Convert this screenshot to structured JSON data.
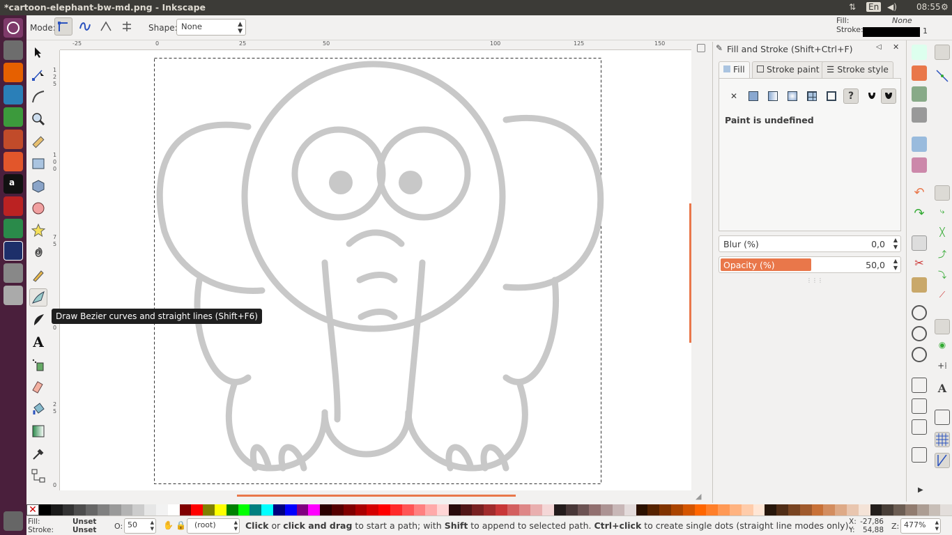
{
  "window": {
    "title": "*cartoon-elephant-bw-md.png - Inkscape"
  },
  "tray": {
    "keyboard": "En",
    "time": "08:55"
  },
  "top_style": {
    "fill_label": "Fill:",
    "fill_value": "None",
    "stroke_label": "Stroke:",
    "stroke_width": "1"
  },
  "toolbar": {
    "mode_label": "Mode:",
    "shape_label": "Shape:",
    "shape_value": "None"
  },
  "ruler": {
    "h_ticks": [
      "-25",
      "0",
      "25",
      "50",
      "100",
      "125",
      "150"
    ],
    "v_ticks": [
      "1",
      "2",
      "5",
      "1",
      "0",
      "0",
      "7",
      "5",
      "5",
      "0",
      "2",
      "5",
      "0"
    ]
  },
  "tooltip": "Draw Bezier curves and straight lines (Shift+F6)",
  "panel": {
    "title": "Fill and Stroke (Shift+Ctrl+F)",
    "tabs": [
      "Fill",
      "Stroke paint",
      "Stroke style"
    ],
    "paint_status": "Paint is undefined",
    "blur_label": "Blur (%)",
    "blur_value": "0,0",
    "opacity_label": "Opacity (%)",
    "opacity_value": "50,0",
    "opacity_fraction": 0.5
  },
  "status": {
    "fill_label": "Fill:",
    "fill_value": "Unset",
    "stroke_label": "Stroke:",
    "stroke_value": "Unset",
    "o_label": "O:",
    "o_value": "50",
    "layer": "(root)",
    "message_parts": [
      {
        "t": "Click",
        "b": true
      },
      {
        "t": " or ",
        "b": false
      },
      {
        "t": "click and drag",
        "b": true
      },
      {
        "t": " to start a path; with ",
        "b": false
      },
      {
        "t": "Shift",
        "b": true
      },
      {
        "t": " to append to selected path. ",
        "b": false
      },
      {
        "t": "Ctrl+click",
        "b": true
      },
      {
        "t": " to create single dots (straight line modes only).",
        "b": false
      }
    ],
    "x_label": "X:",
    "x_value": "-27,86",
    "y_label": "Y:",
    "y_value": "54,88",
    "z_label": "Z:",
    "zoom": "477%"
  },
  "colors": {
    "accent": "#e9774a",
    "launcher": "#4a1f3c",
    "topbar": "#3c3b37"
  },
  "palette": [
    "#000000",
    "#1a1a1a",
    "#333333",
    "#4d4d4d",
    "#666666",
    "#808080",
    "#999999",
    "#b3b3b3",
    "#cccccc",
    "#e6e6e6",
    "#f2f2f2",
    "#ffffff",
    "#800000",
    "#ff0000",
    "#808000",
    "#ffff00",
    "#008000",
    "#00ff00",
    "#008080",
    "#00ffff",
    "#000080",
    "#0000ff",
    "#800080",
    "#ff00ff",
    "#2b0000",
    "#550000",
    "#800000",
    "#aa0000",
    "#d40000",
    "#ff0000",
    "#ff2a2a",
    "#ff5555",
    "#ff8080",
    "#ffaaaa",
    "#ffd5d5",
    "#280b0b",
    "#501616",
    "#782121",
    "#a02c2c",
    "#c83737",
    "#d35f5f",
    "#de8787",
    "#e9afaf",
    "#f4d7d7",
    "#241c1c",
    "#483737",
    "#6c5353",
    "#916f6f",
    "#ac9393",
    "#c8b7b7",
    "#e3dbdb",
    "#2b1100",
    "#552200",
    "#803300",
    "#aa4400",
    "#d45500",
    "#ff6600",
    "#ff7f2a",
    "#ff9955",
    "#ffb380",
    "#ffccaa",
    "#ffe6d5",
    "#28170b",
    "#502d16",
    "#784421",
    "#a05a2c",
    "#c87137",
    "#d38d5f",
    "#deaa87",
    "#e9c6af",
    "#f4e3d7",
    "#241f1c",
    "#483e37",
    "#6c5d53",
    "#917c6f",
    "#ac9d93",
    "#c8beb7",
    "#e3dedb"
  ]
}
